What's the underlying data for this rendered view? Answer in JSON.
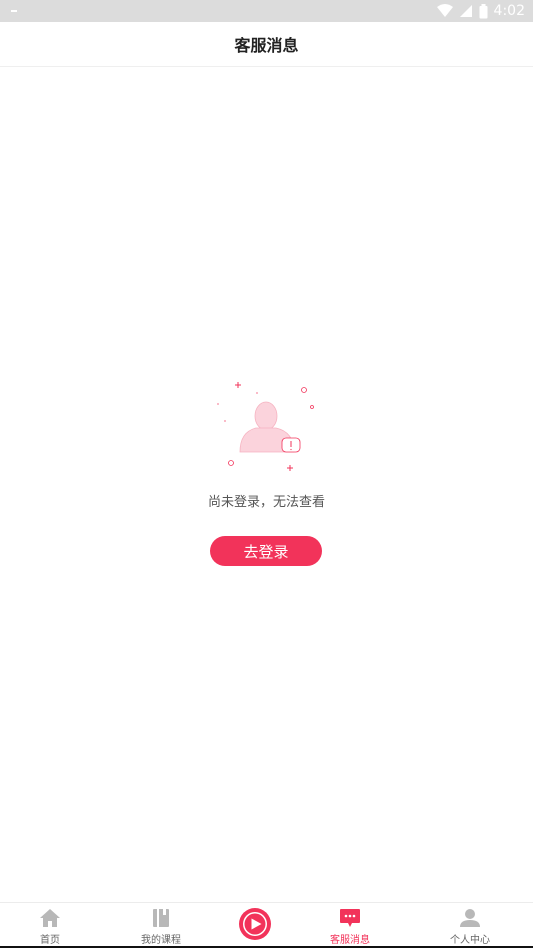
{
  "status_bar": {
    "time": "4:02"
  },
  "header": {
    "title": "客服消息"
  },
  "empty_state": {
    "message": "尚未登录，无法查看",
    "login_button_label": "去登录"
  },
  "tabbar": {
    "items": [
      {
        "label": "首页",
        "icon": "home-icon",
        "active": false
      },
      {
        "label": "我的课程",
        "icon": "book-icon",
        "active": false
      },
      {
        "label": "",
        "icon": "play-icon",
        "active": false
      },
      {
        "label": "客服消息",
        "icon": "chat-icon",
        "active": true
      },
      {
        "label": "个人中心",
        "icon": "user-icon",
        "active": false
      }
    ]
  },
  "colors": {
    "accent": "#f2335a",
    "status_bar_bg": "#dcdcdc",
    "illustration_fill": "#fbd3dc"
  }
}
